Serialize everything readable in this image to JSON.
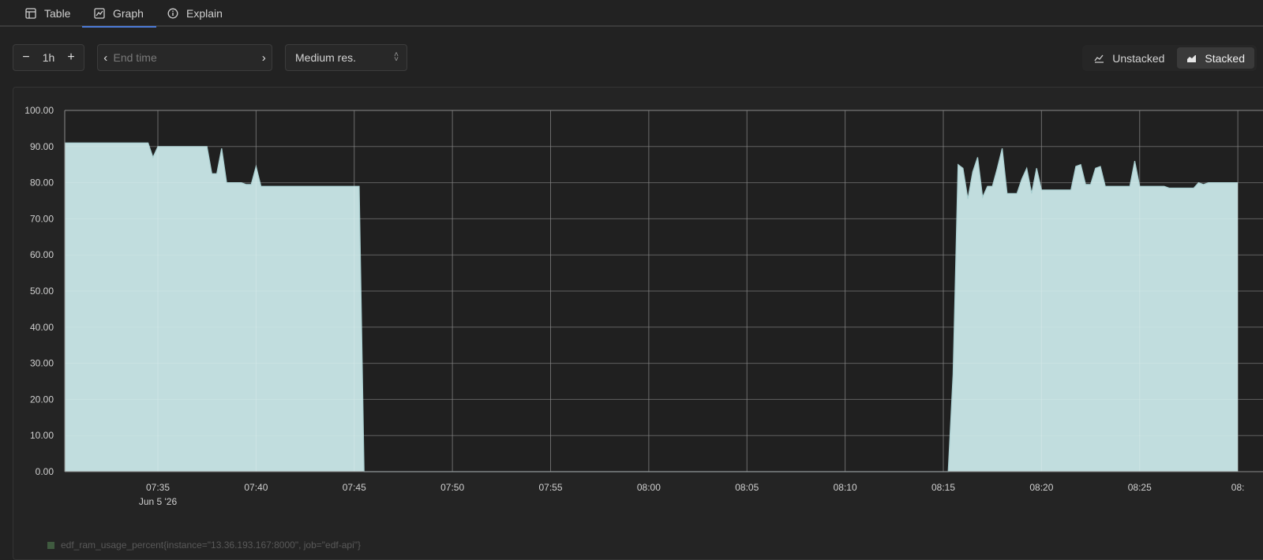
{
  "tabs": [
    {
      "label": "Table",
      "icon": "table-icon"
    },
    {
      "label": "Graph",
      "icon": "graph-icon",
      "active": true
    },
    {
      "label": "Explain",
      "icon": "info-icon"
    }
  ],
  "controls": {
    "range_value": "1h",
    "end_time_placeholder": "End time",
    "resolution": "Medium res.",
    "unstacked_label": "Unstacked",
    "stacked_label": "Stacked",
    "stacked_active": true
  },
  "colors": {
    "fill": "#c6e3e4",
    "stroke": "#a9cfd1",
    "accent": "#4c7bd9",
    "legend_swatch": "#3f5a3f"
  },
  "chart_data": {
    "type": "area",
    "stacked": true,
    "ylim": [
      0,
      100
    ],
    "y_ticks": [
      "0.00",
      "10.00",
      "20.00",
      "30.00",
      "40.00",
      "50.00",
      "60.00",
      "70.00",
      "80.00",
      "90.00",
      "100.00"
    ],
    "x_ticks": [
      "07:35",
      "07:40",
      "07:45",
      "07:50",
      "07:55",
      "08:00",
      "08:05",
      "08:10",
      "08:15",
      "08:20",
      "08:25",
      "08:"
    ],
    "x_sublabel": "Jun 5 '26",
    "grid": true,
    "series": [
      {
        "name": "edf_ram_usage_percent{instance=\"13.36.193.167:8000\", job=\"edf-api\"}",
        "points": [
          [
            "07:30:15",
            91.0
          ],
          [
            "07:34:30",
            91.0
          ],
          [
            "07:34:45",
            87.0
          ],
          [
            "07:35:00",
            90.0
          ],
          [
            "07:37:30",
            90.0
          ],
          [
            "07:37:45",
            82.5
          ],
          [
            "07:38:00",
            82.5
          ],
          [
            "07:38:15",
            89.5
          ],
          [
            "07:38:30",
            80.0
          ],
          [
            "07:39:15",
            80.0
          ],
          [
            "07:39:30",
            79.5
          ],
          [
            "07:39:45",
            79.5
          ],
          [
            "07:40:00",
            84.5
          ],
          [
            "07:40:15",
            79.0
          ],
          [
            "07:45:15",
            79.0
          ],
          [
            "07:45:30",
            0.0
          ],
          [
            "08:15:15",
            0.0
          ],
          [
            "08:15:30",
            27.0
          ],
          [
            "08:15:45",
            85.0
          ],
          [
            "08:16:00",
            84.0
          ],
          [
            "08:16:15",
            75.5
          ],
          [
            "08:16:30",
            83.0
          ],
          [
            "08:16:45",
            87.0
          ],
          [
            "08:17:00",
            76.0
          ],
          [
            "08:17:15",
            79.0
          ],
          [
            "08:17:30",
            79.0
          ],
          [
            "08:17:45",
            84.0
          ],
          [
            "08:18:00",
            89.5
          ],
          [
            "08:18:15",
            77.0
          ],
          [
            "08:18:45",
            77.0
          ],
          [
            "08:19:00",
            81.0
          ],
          [
            "08:19:15",
            84.0
          ],
          [
            "08:19:30",
            77.0
          ],
          [
            "08:19:45",
            84.0
          ],
          [
            "08:20:00",
            78.0
          ],
          [
            "08:21:30",
            78.0
          ],
          [
            "08:21:45",
            84.5
          ],
          [
            "08:22:00",
            85.0
          ],
          [
            "08:22:15",
            79.5
          ],
          [
            "08:22:30",
            79.5
          ],
          [
            "08:22:45",
            84.0
          ],
          [
            "08:23:00",
            84.5
          ],
          [
            "08:23:15",
            79.0
          ],
          [
            "08:24:30",
            79.0
          ],
          [
            "08:24:45",
            86.0
          ],
          [
            "08:25:00",
            79.0
          ],
          [
            "08:26:15",
            79.0
          ],
          [
            "08:26:30",
            78.5
          ],
          [
            "08:27:45",
            78.5
          ],
          [
            "08:28:00",
            80.0
          ],
          [
            "08:28:15",
            79.5
          ],
          [
            "08:28:30",
            80.0
          ],
          [
            "08:30:00",
            80.0
          ]
        ]
      }
    ]
  },
  "legend": {
    "label": "edf_ram_usage_percent{instance=\"13.36.193.167:8000\", job=\"edf-api\"}"
  }
}
